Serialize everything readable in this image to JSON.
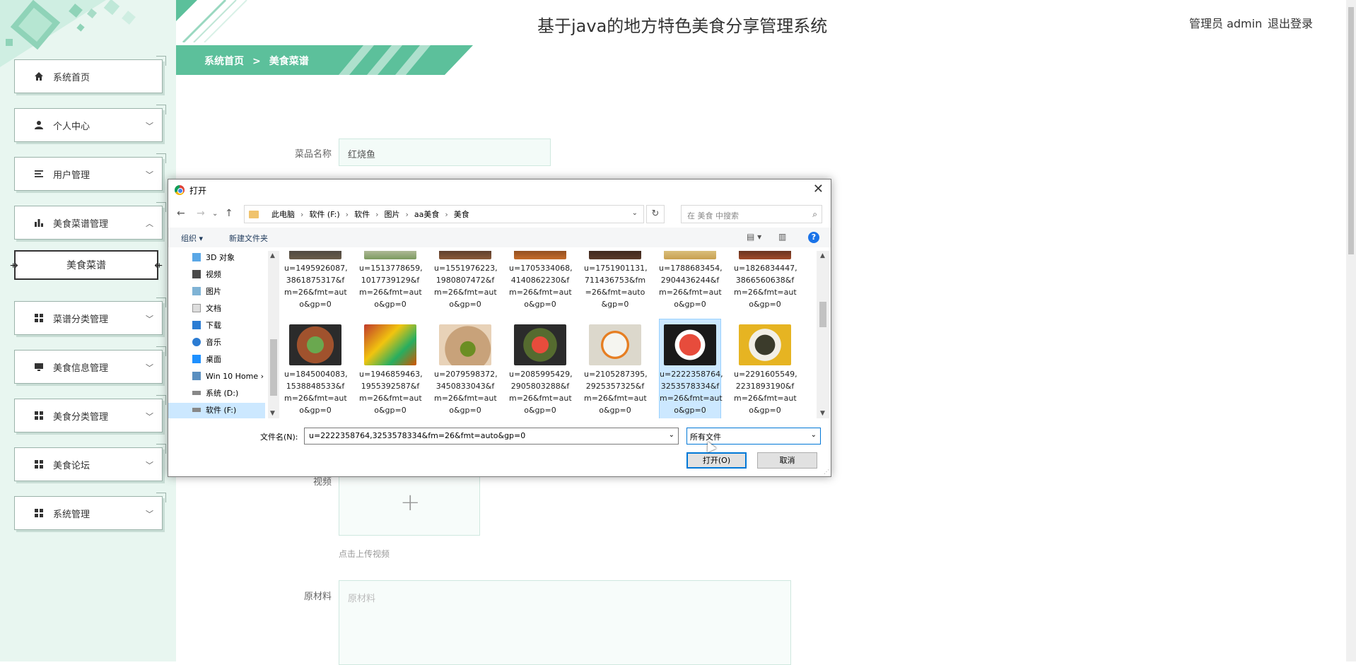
{
  "header": {
    "title": "基于java的地方特色美食分享管理系统",
    "admin": "管理员 admin",
    "logout": "退出登录",
    "breadcrumb": {
      "home": "系统首页",
      "sep": ">",
      "current": "美食菜谱"
    }
  },
  "colors": {
    "accent": "#5cc09b",
    "sidebar_bg": "#e8f6f0",
    "dialog_select": "#cce8ff"
  },
  "sidebar": {
    "items": [
      {
        "label": "系统首页",
        "icon": "home-icon"
      },
      {
        "label": "个人中心",
        "icon": "user-icon"
      },
      {
        "label": "用户管理",
        "icon": "list-icon"
      },
      {
        "label": "美食菜谱管理",
        "icon": "bar-chart-icon"
      },
      {
        "label": "菜谱分类管理",
        "icon": "grid-icon"
      },
      {
        "label": "美食信息管理",
        "icon": "monitor-icon"
      },
      {
        "label": "美食分类管理",
        "icon": "grid-icon"
      },
      {
        "label": "美食论坛",
        "icon": "grid-icon"
      },
      {
        "label": "系统管理",
        "icon": "grid-icon"
      }
    ],
    "sub_item": "美食菜谱"
  },
  "form": {
    "dish_label": "菜品名称",
    "dish_value": "红烧鱼",
    "video_label": "视频",
    "upload_hint": "点击上传视频",
    "ingredients_label": "原材料",
    "ingredients_placeholder": "原材料"
  },
  "dialog": {
    "title": "打开",
    "path": [
      "此电脑",
      "软件 (F:)",
      "软件",
      "图片",
      "aa美食",
      "美食"
    ],
    "path_sep": "›",
    "search_placeholder": "在 美食 中搜索",
    "toolbar": {
      "organize": "组织 ▾",
      "new_folder": "新建文件夹"
    },
    "nav": [
      "3D 对象",
      "视频",
      "图片",
      "文档",
      "下载",
      "音乐",
      "桌面",
      "Win 10 Home ›",
      "系统 (D:)",
      "软件 (F:)"
    ],
    "nav_selected": "软件 (F:)",
    "files_row1": [
      "u=1495926087,\n3861875317&f\nm=26&fmt=aut\no&gp=0",
      "u=1513778659,\n1017739129&f\nm=26&fmt=aut\no&gp=0",
      "u=1551976223,\n1980807472&f\nm=26&fmt=aut\no&gp=0",
      "u=1705334068,\n4140862230&f\nm=26&fmt=aut\no&gp=0",
      "u=1751901131,\n711436753&fm\n=26&fmt=auto\n&gp=0",
      "u=1788683454,\n2904436244&f\nm=26&fmt=aut\no&gp=0",
      "u=1826834447,\n3866560638&f\nm=26&fmt=aut\no&gp=0"
    ],
    "files_row2": [
      "u=1845004083,\n1538848533&f\nm=26&fmt=aut\no&gp=0",
      "u=1946859463,\n1955392587&f\nm=26&fmt=aut\no&gp=0",
      "u=2079598372,\n3450833043&f\nm=26&fmt=aut\no&gp=0",
      "u=2085995429,\n2905803288&f\nm=26&fmt=aut\no&gp=0",
      "u=2105287395,\n2925357325&f\nm=26&fmt=aut\no&gp=0",
      "u=2222358764,\n3253578334&f\nm=26&fmt=aut\no&gp=0",
      "u=2291605549,\n2231893190&f\nm=26&fmt=aut\no&gp=0"
    ],
    "selected_file": "u=2222358764,\n3253578334&f\nm=26&fmt=aut\no&gp=0",
    "filename_label": "文件名(N):",
    "filename_value": "u=2222358764,3253578334&fm=26&fmt=auto&gp=0",
    "filetype": "所有文件",
    "open_btn": "打开(O)",
    "cancel_btn": "取消"
  }
}
